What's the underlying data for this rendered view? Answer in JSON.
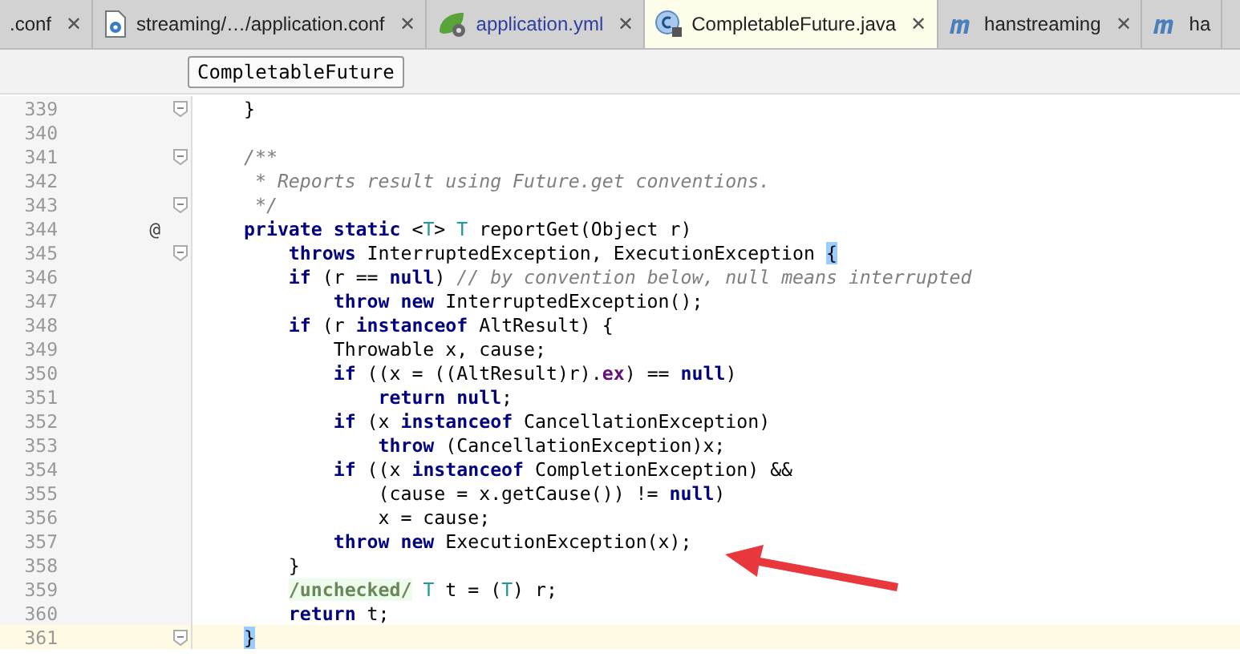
{
  "tabs": [
    {
      "label": ".conf",
      "kind": "plain",
      "selected": false,
      "close": "✕"
    },
    {
      "label": "streaming/…/application.conf",
      "kind": "config",
      "selected": false,
      "close": "✕"
    },
    {
      "label": "application.yml",
      "kind": "spring",
      "selected": false,
      "close": "✕"
    },
    {
      "label": "CompletableFuture.java",
      "kind": "class",
      "selected": true,
      "close": "✕"
    },
    {
      "label": "hanstreaming",
      "kind": "module",
      "selected": false,
      "close": "✕"
    },
    {
      "label": "ha",
      "kind": "module",
      "selected": false
    }
  ],
  "tooltip": "CompletableFuture",
  "lines": [
    {
      "number": "339",
      "fold": true,
      "tokens": [
        {
          "text": "}",
          "kind": "plain"
        }
      ]
    },
    {
      "number": "340"
    },
    {
      "number": "341",
      "fold": true,
      "tokens": [
        {
          "text": "/**",
          "kind": "comment"
        }
      ]
    },
    {
      "number": "342",
      "tokens": [
        {
          "text": " * Reports result using Future.get conventions.",
          "kind": "comment"
        }
      ]
    },
    {
      "number": "343",
      "fold": true,
      "tokens": [
        {
          "text": " */",
          "kind": "comment"
        }
      ]
    },
    {
      "number": "344",
      "marker": "@",
      "tokens": [
        {
          "text": "private static ",
          "kind": "keyword"
        },
        {
          "text": "<",
          "kind": "plain"
        },
        {
          "text": "T",
          "kind": "typeparam"
        },
        {
          "text": "> ",
          "kind": "plain"
        },
        {
          "text": "T",
          "kind": "typeparam"
        },
        {
          "text": " reportGet(Object r)",
          "kind": "plain"
        }
      ]
    },
    {
      "number": "345",
      "fold": true,
      "tokens": [
        {
          "text": "    throws ",
          "kind": "keyword"
        },
        {
          "text": "InterruptedException, ExecutionException ",
          "kind": "plain"
        },
        {
          "text": "{",
          "kind": "matched"
        }
      ]
    },
    {
      "number": "346",
      "tokens": [
        {
          "text": "    if ",
          "kind": "keyword"
        },
        {
          "text": "(r == ",
          "kind": "plain"
        },
        {
          "text": "null",
          "kind": "keyword"
        },
        {
          "text": ") ",
          "kind": "plain"
        },
        {
          "text": "// by convention below, null means interrupted",
          "kind": "comment"
        }
      ]
    },
    {
      "number": "347",
      "tokens": [
        {
          "text": "        throw new ",
          "kind": "keyword"
        },
        {
          "text": "InterruptedException();",
          "kind": "plain"
        }
      ]
    },
    {
      "number": "348",
      "tokens": [
        {
          "text": "    if ",
          "kind": "keyword"
        },
        {
          "text": "(r ",
          "kind": "plain"
        },
        {
          "text": "instanceof ",
          "kind": "keyword"
        },
        {
          "text": "AltResult) {",
          "kind": "plain"
        }
      ]
    },
    {
      "number": "349",
      "tokens": [
        {
          "text": "        Throwable x, cause;",
          "kind": "plain"
        }
      ]
    },
    {
      "number": "350",
      "tokens": [
        {
          "text": "        if ",
          "kind": "keyword"
        },
        {
          "text": "((x = ((AltResult)r).",
          "kind": "plain"
        },
        {
          "text": "ex",
          "kind": "field"
        },
        {
          "text": ") == ",
          "kind": "plain"
        },
        {
          "text": "null",
          "kind": "keyword"
        },
        {
          "text": ")",
          "kind": "plain"
        }
      ]
    },
    {
      "number": "351",
      "tokens": [
        {
          "text": "            return null",
          "kind": "keyword"
        },
        {
          "text": ";",
          "kind": "plain"
        }
      ]
    },
    {
      "number": "352",
      "tokens": [
        {
          "text": "        if ",
          "kind": "keyword"
        },
        {
          "text": "(x ",
          "kind": "plain"
        },
        {
          "text": "instanceof ",
          "kind": "keyword"
        },
        {
          "text": "CancellationException)",
          "kind": "plain"
        }
      ]
    },
    {
      "number": "353",
      "tokens": [
        {
          "text": "            throw ",
          "kind": "keyword"
        },
        {
          "text": "(CancellationException)x;",
          "kind": "plain"
        }
      ]
    },
    {
      "number": "354",
      "tokens": [
        {
          "text": "        if ",
          "kind": "keyword"
        },
        {
          "text": "((x ",
          "kind": "plain"
        },
        {
          "text": "instanceof ",
          "kind": "keyword"
        },
        {
          "text": "CompletionException) &&",
          "kind": "plain"
        }
      ]
    },
    {
      "number": "355",
      "tokens": [
        {
          "text": "            (cause = x.getCause()) != ",
          "kind": "plain"
        },
        {
          "text": "null",
          "kind": "keyword"
        },
        {
          "text": ")",
          "kind": "plain"
        }
      ]
    },
    {
      "number": "356",
      "tokens": [
        {
          "text": "            x = cause;",
          "kind": "plain"
        }
      ]
    },
    {
      "number": "357",
      "tokens": [
        {
          "text": "        throw new ",
          "kind": "keyword"
        },
        {
          "text": "ExecutionException(x);",
          "kind": "plain"
        }
      ]
    },
    {
      "number": "358",
      "tokens": [
        {
          "text": "    }",
          "kind": "plain"
        }
      ]
    },
    {
      "number": "359",
      "tokens": [
        {
          "text": "    /unchecked/",
          "kind": "folded"
        },
        {
          "text": " T",
          "kind": "typeparam"
        },
        {
          "text": " t = (",
          "kind": "plain"
        },
        {
          "text": "T",
          "kind": "typeparam"
        },
        {
          "text": ") r;",
          "kind": "plain"
        }
      ]
    },
    {
      "number": "360",
      "tokens": [
        {
          "text": "    return ",
          "kind": "keyword"
        },
        {
          "text": "t;",
          "kind": "plain"
        }
      ]
    },
    {
      "number": "361",
      "fold": true,
      "current": true,
      "tokens": [
        {
          "text": "}",
          "kind": "matched"
        }
      ]
    }
  ]
}
